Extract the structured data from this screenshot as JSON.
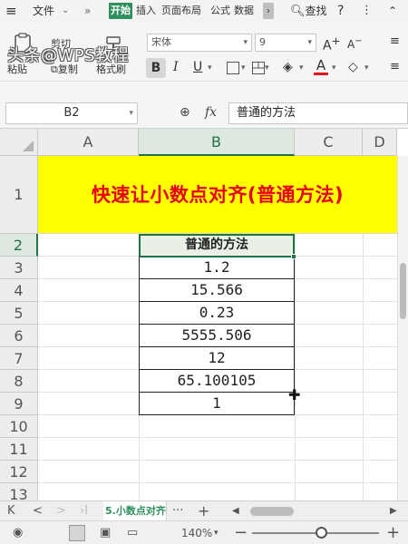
{
  "menubar": {
    "menu_icon": "≡",
    "file_label": "文件",
    "file_caret": "⌄",
    "more_label": "»",
    "tabs": [
      "开始",
      "插入",
      "页面布局",
      "公式",
      "数据"
    ],
    "tab_more": "›",
    "search_label": "查找",
    "help_label": "?",
    "more2_label": "⋮",
    "chevron_label": "⌃"
  },
  "ribbon": {
    "watermark": "头条@WPS教程",
    "cut_label": "剪切",
    "paste_label": "粘贴",
    "copy_label": "复制",
    "format_painter_label": "格式刷",
    "font_name": "宋体",
    "font_size": "9",
    "grow_font": "A",
    "shrink_font": "A",
    "bold": "B",
    "italic": "I",
    "underline": "U",
    "font_color": "A",
    "font_color_hex": "#e60012",
    "dropdown_caret": "▾"
  },
  "formulabar": {
    "cell_ref": "B2",
    "fx": "fx",
    "value": "普通的方法"
  },
  "sheet": {
    "columns": [
      "A",
      "B",
      "C",
      "D"
    ],
    "rows": [
      "1",
      "2",
      "3",
      "4",
      "5",
      "6",
      "7",
      "8",
      "9",
      "10",
      "11",
      "12",
      "13"
    ],
    "title": "快速让小数点对齐(普通方法)",
    "title_color": "#e60012",
    "title_bg": "#ffff00",
    "header": "普通的方法",
    "values": [
      "1.2",
      "15.566",
      "0.23",
      "5555.506",
      "12",
      "65.100105",
      "1"
    ],
    "accent": "#217346"
  },
  "tabbar": {
    "first": "K",
    "prev": "<",
    "next": ">",
    "last": "›I",
    "sheet_name": "5.小数点对齐",
    "dots": "···",
    "add": "+",
    "scroll_left": "◀",
    "scroll_right": "▶"
  },
  "statusbar": {
    "zoom": "140%",
    "zoom_caret": "▾",
    "minus": "−",
    "plus": "+",
    "zoom_percent": 140
  }
}
